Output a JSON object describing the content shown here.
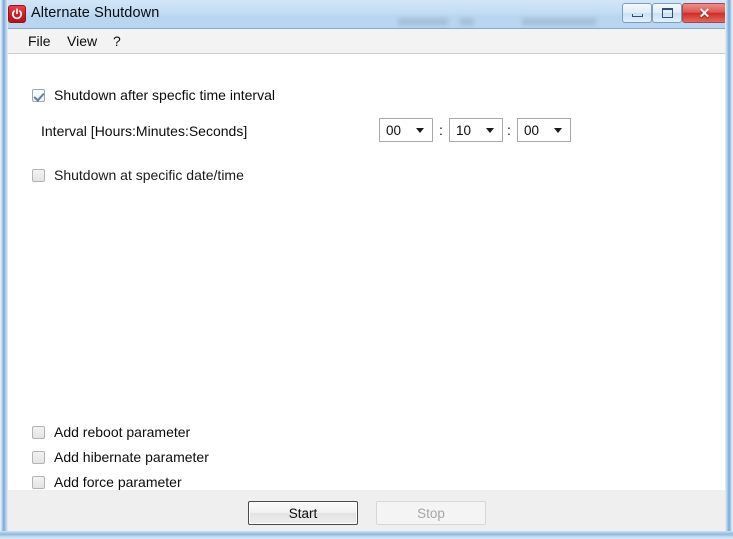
{
  "window": {
    "title": "Alternate Shutdown",
    "app_icon": "power-icon",
    "controls": {
      "minimize": "minimize-icon",
      "maximize": "maximize-icon",
      "close": "✕"
    },
    "accent_color": "#cf1b26",
    "titlebar_color": "#b9d7f2"
  },
  "menubar": {
    "items": [
      {
        "label": "File"
      },
      {
        "label": "View"
      },
      {
        "label": "?"
      }
    ]
  },
  "main": {
    "interval_option": {
      "label": "Shutdown after specfic time interval",
      "checked": true
    },
    "interval_field": {
      "label": "Interval [Hours:Minutes:Seconds]",
      "hours": "00",
      "minutes": "10",
      "seconds": "00",
      "separator": ":"
    },
    "datetime_option": {
      "label": "Shutdown at specific date/time",
      "checked": false
    },
    "parameters": [
      {
        "label": "Add reboot parameter",
        "checked": false
      },
      {
        "label": "Add hibernate parameter",
        "checked": false
      },
      {
        "label": "Add force parameter",
        "checked": false
      }
    ]
  },
  "footer": {
    "start_button": {
      "label": "Start",
      "enabled": true
    },
    "stop_button": {
      "label": "Stop",
      "enabled": false
    }
  }
}
